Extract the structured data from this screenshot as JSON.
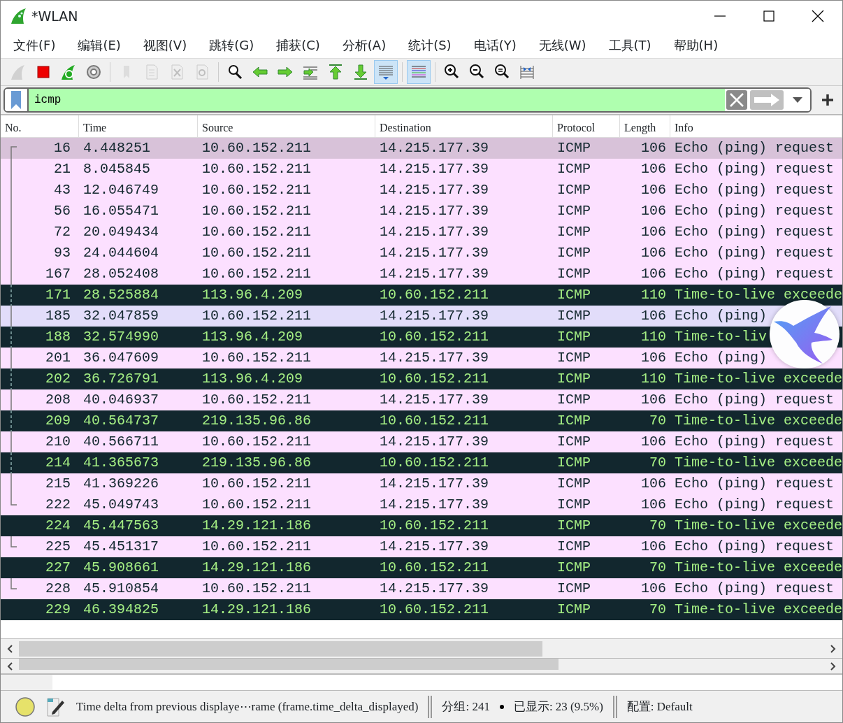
{
  "window": {
    "title": "*WLAN"
  },
  "menu": [
    "文件(F)",
    "编辑(E)",
    "视图(V)",
    "跳转(G)",
    "捕获(C)",
    "分析(A)",
    "统计(S)",
    "电话(Y)",
    "无线(W)",
    "工具(T)",
    "帮助(H)"
  ],
  "toolbar": [
    {
      "kind": "fin",
      "disabled": true,
      "pressed": false
    },
    {
      "kind": "stop",
      "disabled": false,
      "pressed": false
    },
    {
      "kind": "restart",
      "disabled": false,
      "pressed": false
    },
    {
      "kind": "gear",
      "disabled": false,
      "pressed": false
    },
    {
      "kind": "sep"
    },
    {
      "kind": "folder",
      "disabled": true,
      "pressed": false
    },
    {
      "kind": "file",
      "disabled": true,
      "pressed": false
    },
    {
      "kind": "closefile",
      "disabled": true,
      "pressed": false
    },
    {
      "kind": "reload",
      "disabled": true,
      "pressed": false
    },
    {
      "kind": "sep"
    },
    {
      "kind": "find",
      "disabled": false,
      "pressed": false
    },
    {
      "kind": "back",
      "disabled": false,
      "pressed": false
    },
    {
      "kind": "fwd",
      "disabled": false,
      "pressed": false
    },
    {
      "kind": "goto",
      "disabled": false,
      "pressed": false
    },
    {
      "kind": "first",
      "disabled": false,
      "pressed": false
    },
    {
      "kind": "last",
      "disabled": false,
      "pressed": false
    },
    {
      "kind": "autoscroll",
      "disabled": false,
      "pressed": true
    },
    {
      "kind": "sep"
    },
    {
      "kind": "colorize",
      "disabled": false,
      "pressed": true
    },
    {
      "kind": "sep"
    },
    {
      "kind": "zoomin",
      "disabled": false,
      "pressed": false
    },
    {
      "kind": "zoomout",
      "disabled": false,
      "pressed": false
    },
    {
      "kind": "zoomreset",
      "disabled": false,
      "pressed": false
    },
    {
      "kind": "resize",
      "disabled": false,
      "pressed": false
    }
  ],
  "filter": {
    "value": "icmp",
    "valid": true
  },
  "table": {
    "columns": [
      "No.",
      "Time",
      "Source",
      "Destination",
      "Protocol",
      "Length",
      "Info"
    ],
    "rows": [
      {
        "no": "16",
        "time": "4.448251",
        "source": "10.60.152.211",
        "destination": "14.215.177.39",
        "protocol": "ICMP",
        "length": "106",
        "info": "Echo (ping) request",
        "kind": "request",
        "selected": true,
        "hovered": false,
        "related": true
      },
      {
        "no": "21",
        "time": "8.045845",
        "source": "10.60.152.211",
        "destination": "14.215.177.39",
        "protocol": "ICMP",
        "length": "106",
        "info": "Echo (ping) request",
        "kind": "request",
        "selected": false,
        "hovered": false,
        "related": true
      },
      {
        "no": "43",
        "time": "12.046749",
        "source": "10.60.152.211",
        "destination": "14.215.177.39",
        "protocol": "ICMP",
        "length": "106",
        "info": "Echo (ping) request",
        "kind": "request",
        "selected": false,
        "hovered": false,
        "related": true
      },
      {
        "no": "56",
        "time": "16.055471",
        "source": "10.60.152.211",
        "destination": "14.215.177.39",
        "protocol": "ICMP",
        "length": "106",
        "info": "Echo (ping) request",
        "kind": "request",
        "selected": false,
        "hovered": false,
        "related": true
      },
      {
        "no": "72",
        "time": "20.049434",
        "source": "10.60.152.211",
        "destination": "14.215.177.39",
        "protocol": "ICMP",
        "length": "106",
        "info": "Echo (ping) request",
        "kind": "request",
        "selected": false,
        "hovered": false,
        "related": true
      },
      {
        "no": "93",
        "time": "24.044604",
        "source": "10.60.152.211",
        "destination": "14.215.177.39",
        "protocol": "ICMP",
        "length": "106",
        "info": "Echo (ping) request",
        "kind": "request",
        "selected": false,
        "hovered": false,
        "related": true
      },
      {
        "no": "167",
        "time": "28.052408",
        "source": "10.60.152.211",
        "destination": "14.215.177.39",
        "protocol": "ICMP",
        "length": "106",
        "info": "Echo (ping) request",
        "kind": "request",
        "selected": false,
        "hovered": false,
        "related": true
      },
      {
        "no": "171",
        "time": "28.525884",
        "source": "113.96.4.209",
        "destination": "10.60.152.211",
        "protocol": "ICMP",
        "length": "110",
        "info": "Time-to-live exceede",
        "kind": "ttl",
        "selected": false,
        "hovered": false,
        "related": true
      },
      {
        "no": "185",
        "time": "32.047859",
        "source": "10.60.152.211",
        "destination": "14.215.177.39",
        "protocol": "ICMP",
        "length": "106",
        "info": "Echo (ping)",
        "kind": "request",
        "selected": false,
        "hovered": true,
        "related": true
      },
      {
        "no": "188",
        "time": "32.574990",
        "source": "113.96.4.209",
        "destination": "10.60.152.211",
        "protocol": "ICMP",
        "length": "110",
        "info": "Time-to-liv",
        "kind": "ttl",
        "selected": false,
        "hovered": false,
        "related": true
      },
      {
        "no": "201",
        "time": "36.047609",
        "source": "10.60.152.211",
        "destination": "14.215.177.39",
        "protocol": "ICMP",
        "length": "106",
        "info": "Echo (ping)",
        "kind": "request",
        "selected": false,
        "hovered": false,
        "related": true
      },
      {
        "no": "202",
        "time": "36.726791",
        "source": "113.96.4.209",
        "destination": "10.60.152.211",
        "protocol": "ICMP",
        "length": "110",
        "info": "Time-to-live exceede",
        "kind": "ttl",
        "selected": false,
        "hovered": false,
        "related": true
      },
      {
        "no": "208",
        "time": "40.046937",
        "source": "10.60.152.211",
        "destination": "14.215.177.39",
        "protocol": "ICMP",
        "length": "106",
        "info": "Echo (ping) request",
        "kind": "request",
        "selected": false,
        "hovered": false,
        "related": true
      },
      {
        "no": "209",
        "time": "40.564737",
        "source": "219.135.96.86",
        "destination": "10.60.152.211",
        "protocol": "ICMP",
        "length": "70",
        "info": "Time-to-live exceede",
        "kind": "ttl",
        "selected": false,
        "hovered": false,
        "related": true
      },
      {
        "no": "210",
        "time": "40.566711",
        "source": "10.60.152.211",
        "destination": "14.215.177.39",
        "protocol": "ICMP",
        "length": "106",
        "info": "Echo (ping) request",
        "kind": "request",
        "selected": false,
        "hovered": false,
        "related": true
      },
      {
        "no": "214",
        "time": "41.365673",
        "source": "219.135.96.86",
        "destination": "10.60.152.211",
        "protocol": "ICMP",
        "length": "70",
        "info": "Time-to-live exceede",
        "kind": "ttl",
        "selected": false,
        "hovered": false,
        "related": true
      },
      {
        "no": "215",
        "time": "41.369226",
        "source": "10.60.152.211",
        "destination": "14.215.177.39",
        "protocol": "ICMP",
        "length": "106",
        "info": "Echo (ping) request",
        "kind": "request",
        "selected": false,
        "hovered": false,
        "related": true
      },
      {
        "no": "222",
        "time": "45.049743",
        "source": "10.60.152.211",
        "destination": "14.215.177.39",
        "protocol": "ICMP",
        "length": "106",
        "info": "Echo (ping) request",
        "kind": "request",
        "selected": false,
        "hovered": false,
        "related": true
      },
      {
        "no": "224",
        "time": "45.447563",
        "source": "14.29.121.186",
        "destination": "10.60.152.211",
        "protocol": "ICMP",
        "length": "70",
        "info": "Time-to-live exceede",
        "kind": "ttl",
        "selected": false,
        "hovered": false,
        "related": false
      },
      {
        "no": "225",
        "time": "45.451317",
        "source": "10.60.152.211",
        "destination": "14.215.177.39",
        "protocol": "ICMP",
        "length": "106",
        "info": "Echo (ping) request",
        "kind": "request",
        "selected": false,
        "hovered": false,
        "related": true
      },
      {
        "no": "227",
        "time": "45.908661",
        "source": "14.29.121.186",
        "destination": "10.60.152.211",
        "protocol": "ICMP",
        "length": "70",
        "info": "Time-to-live exceede",
        "kind": "ttl",
        "selected": false,
        "hovered": false,
        "related": false
      },
      {
        "no": "228",
        "time": "45.910854",
        "source": "10.60.152.211",
        "destination": "14.215.177.39",
        "protocol": "ICMP",
        "length": "106",
        "info": "Echo (ping) request",
        "kind": "request",
        "selected": false,
        "hovered": false,
        "related": true
      },
      {
        "no": "229",
        "time": "46.394825",
        "source": "14.29.121.186",
        "destination": "10.60.152.211",
        "protocol": "ICMP",
        "length": "70",
        "info": "Time-to-live exceede",
        "kind": "ttl",
        "selected": false,
        "hovered": false,
        "related": false
      }
    ]
  },
  "status_bar": {
    "capturing": true,
    "field_hint": "Time delta from previous displaye⋯rame (frame.time_delta_displayed)",
    "packets": "分组: 241",
    "displayed": "已显示: 23 (9.5%)",
    "profile": "配置: Default"
  }
}
